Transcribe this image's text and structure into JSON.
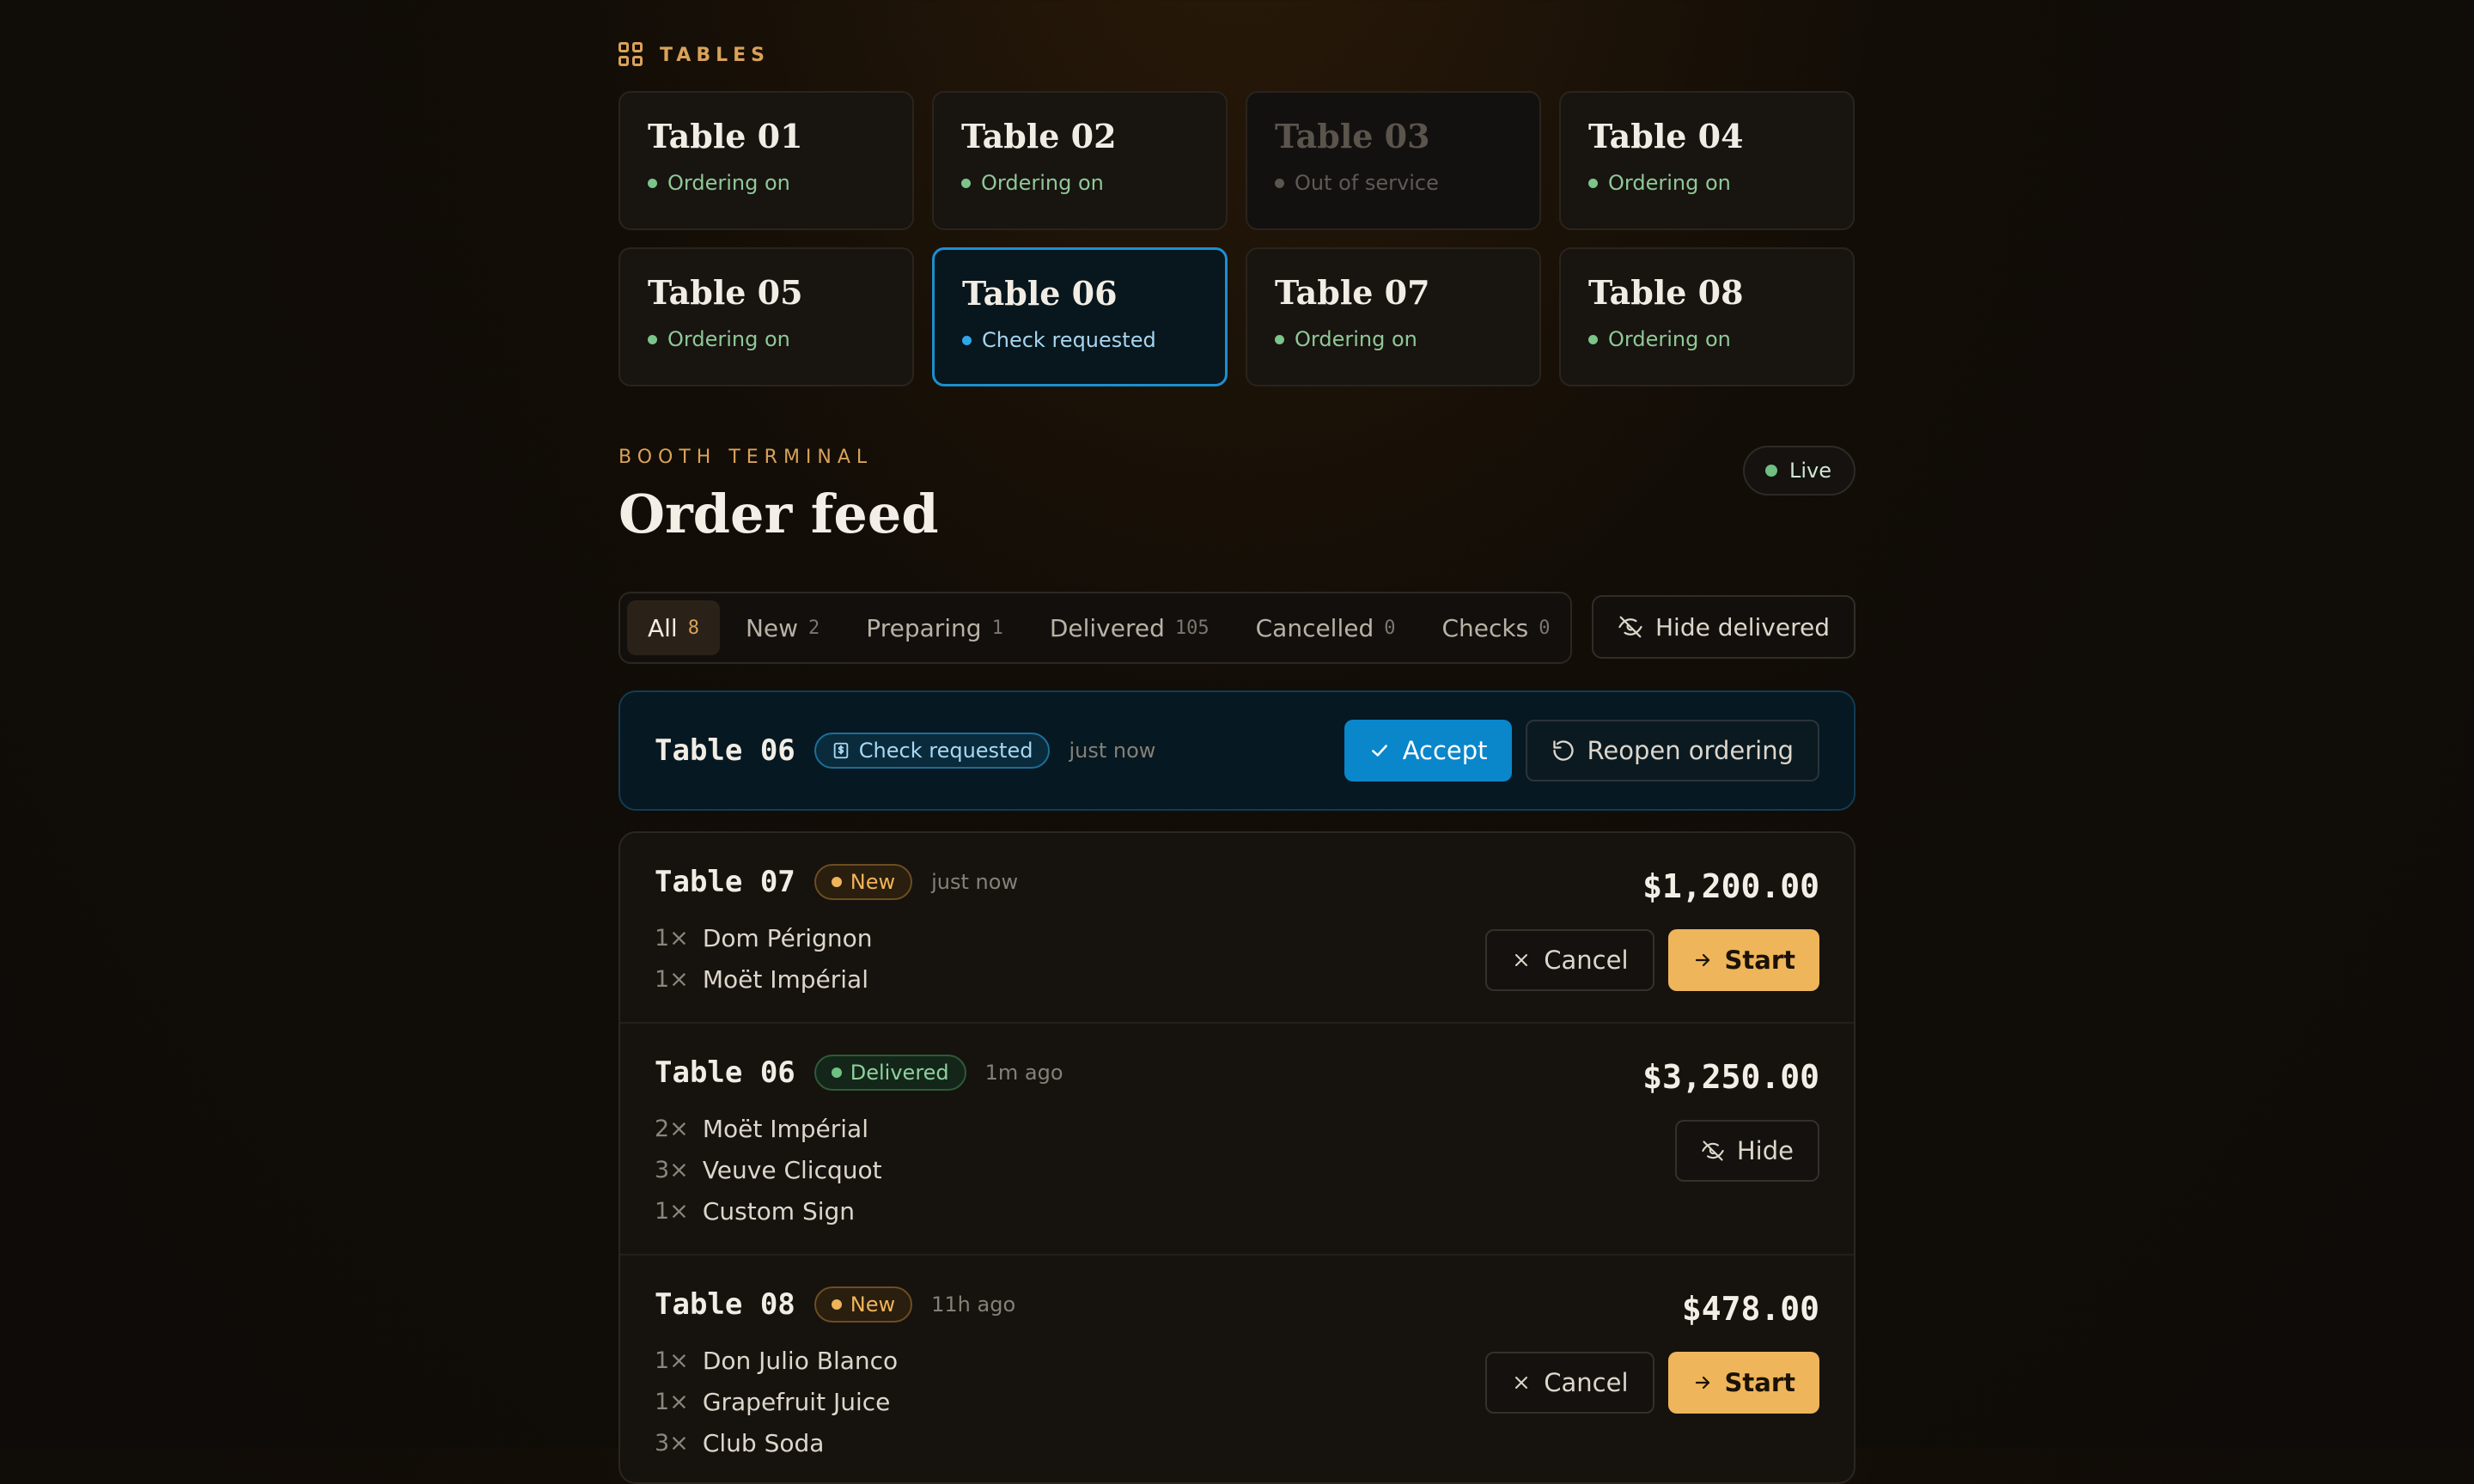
{
  "tables_section": {
    "label": "TABLES",
    "tables": [
      {
        "name": "Table 01",
        "status": "Ordering on",
        "state": "on"
      },
      {
        "name": "Table 02",
        "status": "Ordering on",
        "state": "on"
      },
      {
        "name": "Table 03",
        "status": "Out of service",
        "state": "off"
      },
      {
        "name": "Table 04",
        "status": "Ordering on",
        "state": "on"
      },
      {
        "name": "Table 05",
        "status": "Ordering on",
        "state": "on"
      },
      {
        "name": "Table 06",
        "status": "Check requested",
        "state": "selected"
      },
      {
        "name": "Table 07",
        "status": "Ordering on",
        "state": "on"
      },
      {
        "name": "Table 08",
        "status": "Ordering on",
        "state": "on"
      }
    ]
  },
  "header": {
    "eyebrow": "BOOTH TERMINAL",
    "title": "Order feed",
    "live_label": "Live"
  },
  "filters": {
    "tabs": [
      {
        "label": "All",
        "count": "8"
      },
      {
        "label": "New",
        "count": "2"
      },
      {
        "label": "Preparing",
        "count": "1"
      },
      {
        "label": "Delivered",
        "count": "105"
      },
      {
        "label": "Cancelled",
        "count": "0"
      },
      {
        "label": "Checks",
        "count": "0"
      }
    ],
    "active": "All",
    "hide_delivered_label": "Hide delivered"
  },
  "check_request": {
    "table": "Table 06",
    "badge": "Check requested",
    "time": "just now",
    "accept_label": "Accept",
    "reopen_label": "Reopen ordering"
  },
  "orders": [
    {
      "table": "Table 07",
      "status": "New",
      "time": "just now",
      "total": "$1,200.00",
      "items": [
        {
          "qty": "1×",
          "name": "Dom Pérignon"
        },
        {
          "qty": "1×",
          "name": "Moët Impérial"
        }
      ],
      "cancel_label": "Cancel",
      "start_label": "Start"
    },
    {
      "table": "Table 06",
      "status": "Delivered",
      "time": "1m ago",
      "total": "$3,250.00",
      "items": [
        {
          "qty": "2×",
          "name": "Moët Impérial"
        },
        {
          "qty": "3×",
          "name": "Veuve Clicquot"
        },
        {
          "qty": "1×",
          "name": "Custom Sign"
        }
      ],
      "hide_label": "Hide"
    },
    {
      "table": "Table 08",
      "status": "New",
      "time": "11h ago",
      "total": "$478.00",
      "items": [
        {
          "qty": "1×",
          "name": "Don Julio Blanco"
        },
        {
          "qty": "1×",
          "name": "Grapefruit Juice"
        },
        {
          "qty": "3×",
          "name": "Club Soda"
        }
      ],
      "cancel_label": "Cancel",
      "start_label": "Start"
    }
  ],
  "colors": {
    "accent_amber": "#d9a25a",
    "ordering_green": "#7bc48a",
    "selected_blue": "#1d8fd0",
    "start_button": "#eeb55a",
    "accept_button": "#0a86cb"
  }
}
